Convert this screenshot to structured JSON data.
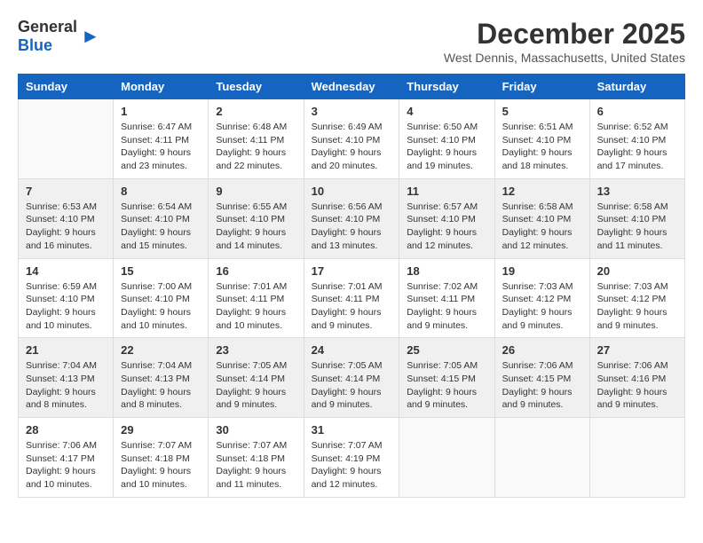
{
  "header": {
    "logo_general": "General",
    "logo_blue": "Blue",
    "month_title": "December 2025",
    "location": "West Dennis, Massachusetts, United States"
  },
  "columns": [
    "Sunday",
    "Monday",
    "Tuesday",
    "Wednesday",
    "Thursday",
    "Friday",
    "Saturday"
  ],
  "weeks": [
    {
      "shaded": false,
      "days": [
        {
          "num": "",
          "info": ""
        },
        {
          "num": "1",
          "info": "Sunrise: 6:47 AM\nSunset: 4:11 PM\nDaylight: 9 hours\nand 23 minutes."
        },
        {
          "num": "2",
          "info": "Sunrise: 6:48 AM\nSunset: 4:11 PM\nDaylight: 9 hours\nand 22 minutes."
        },
        {
          "num": "3",
          "info": "Sunrise: 6:49 AM\nSunset: 4:10 PM\nDaylight: 9 hours\nand 20 minutes."
        },
        {
          "num": "4",
          "info": "Sunrise: 6:50 AM\nSunset: 4:10 PM\nDaylight: 9 hours\nand 19 minutes."
        },
        {
          "num": "5",
          "info": "Sunrise: 6:51 AM\nSunset: 4:10 PM\nDaylight: 9 hours\nand 18 minutes."
        },
        {
          "num": "6",
          "info": "Sunrise: 6:52 AM\nSunset: 4:10 PM\nDaylight: 9 hours\nand 17 minutes."
        }
      ]
    },
    {
      "shaded": true,
      "days": [
        {
          "num": "7",
          "info": "Sunrise: 6:53 AM\nSunset: 4:10 PM\nDaylight: 9 hours\nand 16 minutes."
        },
        {
          "num": "8",
          "info": "Sunrise: 6:54 AM\nSunset: 4:10 PM\nDaylight: 9 hours\nand 15 minutes."
        },
        {
          "num": "9",
          "info": "Sunrise: 6:55 AM\nSunset: 4:10 PM\nDaylight: 9 hours\nand 14 minutes."
        },
        {
          "num": "10",
          "info": "Sunrise: 6:56 AM\nSunset: 4:10 PM\nDaylight: 9 hours\nand 13 minutes."
        },
        {
          "num": "11",
          "info": "Sunrise: 6:57 AM\nSunset: 4:10 PM\nDaylight: 9 hours\nand 12 minutes."
        },
        {
          "num": "12",
          "info": "Sunrise: 6:58 AM\nSunset: 4:10 PM\nDaylight: 9 hours\nand 12 minutes."
        },
        {
          "num": "13",
          "info": "Sunrise: 6:58 AM\nSunset: 4:10 PM\nDaylight: 9 hours\nand 11 minutes."
        }
      ]
    },
    {
      "shaded": false,
      "days": [
        {
          "num": "14",
          "info": "Sunrise: 6:59 AM\nSunset: 4:10 PM\nDaylight: 9 hours\nand 10 minutes."
        },
        {
          "num": "15",
          "info": "Sunrise: 7:00 AM\nSunset: 4:10 PM\nDaylight: 9 hours\nand 10 minutes."
        },
        {
          "num": "16",
          "info": "Sunrise: 7:01 AM\nSunset: 4:11 PM\nDaylight: 9 hours\nand 10 minutes."
        },
        {
          "num": "17",
          "info": "Sunrise: 7:01 AM\nSunset: 4:11 PM\nDaylight: 9 hours\nand 9 minutes."
        },
        {
          "num": "18",
          "info": "Sunrise: 7:02 AM\nSunset: 4:11 PM\nDaylight: 9 hours\nand 9 minutes."
        },
        {
          "num": "19",
          "info": "Sunrise: 7:03 AM\nSunset: 4:12 PM\nDaylight: 9 hours\nand 9 minutes."
        },
        {
          "num": "20",
          "info": "Sunrise: 7:03 AM\nSunset: 4:12 PM\nDaylight: 9 hours\nand 9 minutes."
        }
      ]
    },
    {
      "shaded": true,
      "days": [
        {
          "num": "21",
          "info": "Sunrise: 7:04 AM\nSunset: 4:13 PM\nDaylight: 9 hours\nand 8 minutes."
        },
        {
          "num": "22",
          "info": "Sunrise: 7:04 AM\nSunset: 4:13 PM\nDaylight: 9 hours\nand 8 minutes."
        },
        {
          "num": "23",
          "info": "Sunrise: 7:05 AM\nSunset: 4:14 PM\nDaylight: 9 hours\nand 9 minutes."
        },
        {
          "num": "24",
          "info": "Sunrise: 7:05 AM\nSunset: 4:14 PM\nDaylight: 9 hours\nand 9 minutes."
        },
        {
          "num": "25",
          "info": "Sunrise: 7:05 AM\nSunset: 4:15 PM\nDaylight: 9 hours\nand 9 minutes."
        },
        {
          "num": "26",
          "info": "Sunrise: 7:06 AM\nSunset: 4:15 PM\nDaylight: 9 hours\nand 9 minutes."
        },
        {
          "num": "27",
          "info": "Sunrise: 7:06 AM\nSunset: 4:16 PM\nDaylight: 9 hours\nand 9 minutes."
        }
      ]
    },
    {
      "shaded": false,
      "days": [
        {
          "num": "28",
          "info": "Sunrise: 7:06 AM\nSunset: 4:17 PM\nDaylight: 9 hours\nand 10 minutes."
        },
        {
          "num": "29",
          "info": "Sunrise: 7:07 AM\nSunset: 4:18 PM\nDaylight: 9 hours\nand 10 minutes."
        },
        {
          "num": "30",
          "info": "Sunrise: 7:07 AM\nSunset: 4:18 PM\nDaylight: 9 hours\nand 11 minutes."
        },
        {
          "num": "31",
          "info": "Sunrise: 7:07 AM\nSunset: 4:19 PM\nDaylight: 9 hours\nand 12 minutes."
        },
        {
          "num": "",
          "info": ""
        },
        {
          "num": "",
          "info": ""
        },
        {
          "num": "",
          "info": ""
        }
      ]
    }
  ]
}
